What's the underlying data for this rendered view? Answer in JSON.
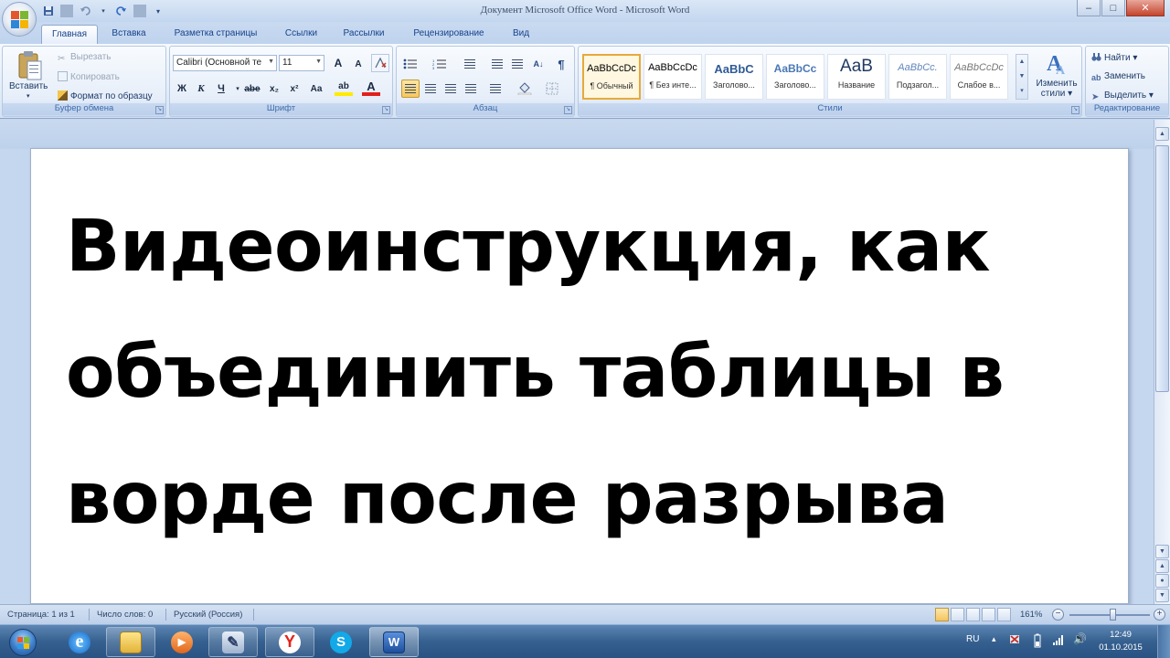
{
  "window": {
    "title": "Документ Microsoft Office Word - Microsoft Word",
    "controls": [
      "–",
      "□",
      "✕"
    ]
  },
  "quick_access": {
    "icons": [
      "save-icon",
      "undo-icon",
      "redo-icon",
      "customize-icon"
    ]
  },
  "tabs": [
    {
      "label": "Главная",
      "active": true
    },
    {
      "label": "Вставка"
    },
    {
      "label": "Разметка страницы"
    },
    {
      "label": "Ссылки"
    },
    {
      "label": "Рассылки"
    },
    {
      "label": "Рецензирование"
    },
    {
      "label": "Вид"
    }
  ],
  "ribbon": {
    "clipboard": {
      "label": "Буфер обмена",
      "paste": "Вставить",
      "cut": "Вырезать",
      "copy": "Копировать",
      "format_painter": "Формат по образцу"
    },
    "font": {
      "label": "Шрифт",
      "font_name": "Calibri (Основной те",
      "font_size": "11",
      "grow": "A",
      "shrink": "A",
      "bold": "Ж",
      "italic": "К",
      "underline": "Ч",
      "strike": "abe",
      "subscript": "x₂",
      "superscript": "x²",
      "case": "Aa",
      "highlight": "ab",
      "color": "A"
    },
    "paragraph": {
      "label": "Абзац",
      "pilcrow": "¶"
    },
    "styles": {
      "label": "Стили",
      "items": [
        {
          "sample": "AaBbCcDc",
          "name": "¶ Обычный",
          "selected": true
        },
        {
          "sample": "AaBbCcDc",
          "name": "¶ Без инте..."
        },
        {
          "sample": "AaBbC",
          "name": "Заголово..."
        },
        {
          "sample": "AaBbCc",
          "name": "Заголово..."
        },
        {
          "sample": "AaB",
          "name": "Название"
        },
        {
          "sample": "AaBbCc.",
          "name": "Подзагол..."
        },
        {
          "sample": "AaBbCcDc",
          "name": "Слабое в..."
        }
      ],
      "change_styles_line1": "Изменить",
      "change_styles_line2": "стили"
    },
    "editing": {
      "label": "Редактирование",
      "find": "Найти",
      "replace": "Заменить",
      "select": "Выделить"
    }
  },
  "document": {
    "lines": [
      "Видеоинструкция, как",
      "объединить таблицы в",
      "ворде после разрыва"
    ]
  },
  "statusbar": {
    "page": "Страница: 1 из 1",
    "words": "Число слов: 0",
    "language": "Русский (Россия)",
    "zoom": "161%",
    "zoom_minus": "−",
    "zoom_plus": "+"
  },
  "taskbar": {
    "apps": [
      {
        "icon": "internet-explorer-icon",
        "glyph": "e"
      },
      {
        "icon": "file-explorer-icon",
        "glyph": ""
      },
      {
        "icon": "media-player-icon",
        "glyph": "▶"
      },
      {
        "icon": "paint-icon",
        "glyph": "✎"
      },
      {
        "icon": "yandex-browser-icon",
        "glyph": "Y"
      },
      {
        "icon": "skype-icon",
        "glyph": "S"
      },
      {
        "icon": "word-icon",
        "glyph": "W"
      }
    ],
    "language": "RU",
    "time": "12:49",
    "date": "01.10.2015"
  },
  "colors": {
    "ribbon_text": "#15428b",
    "accent": "#e7a93b",
    "taskbar": "#35608f"
  }
}
